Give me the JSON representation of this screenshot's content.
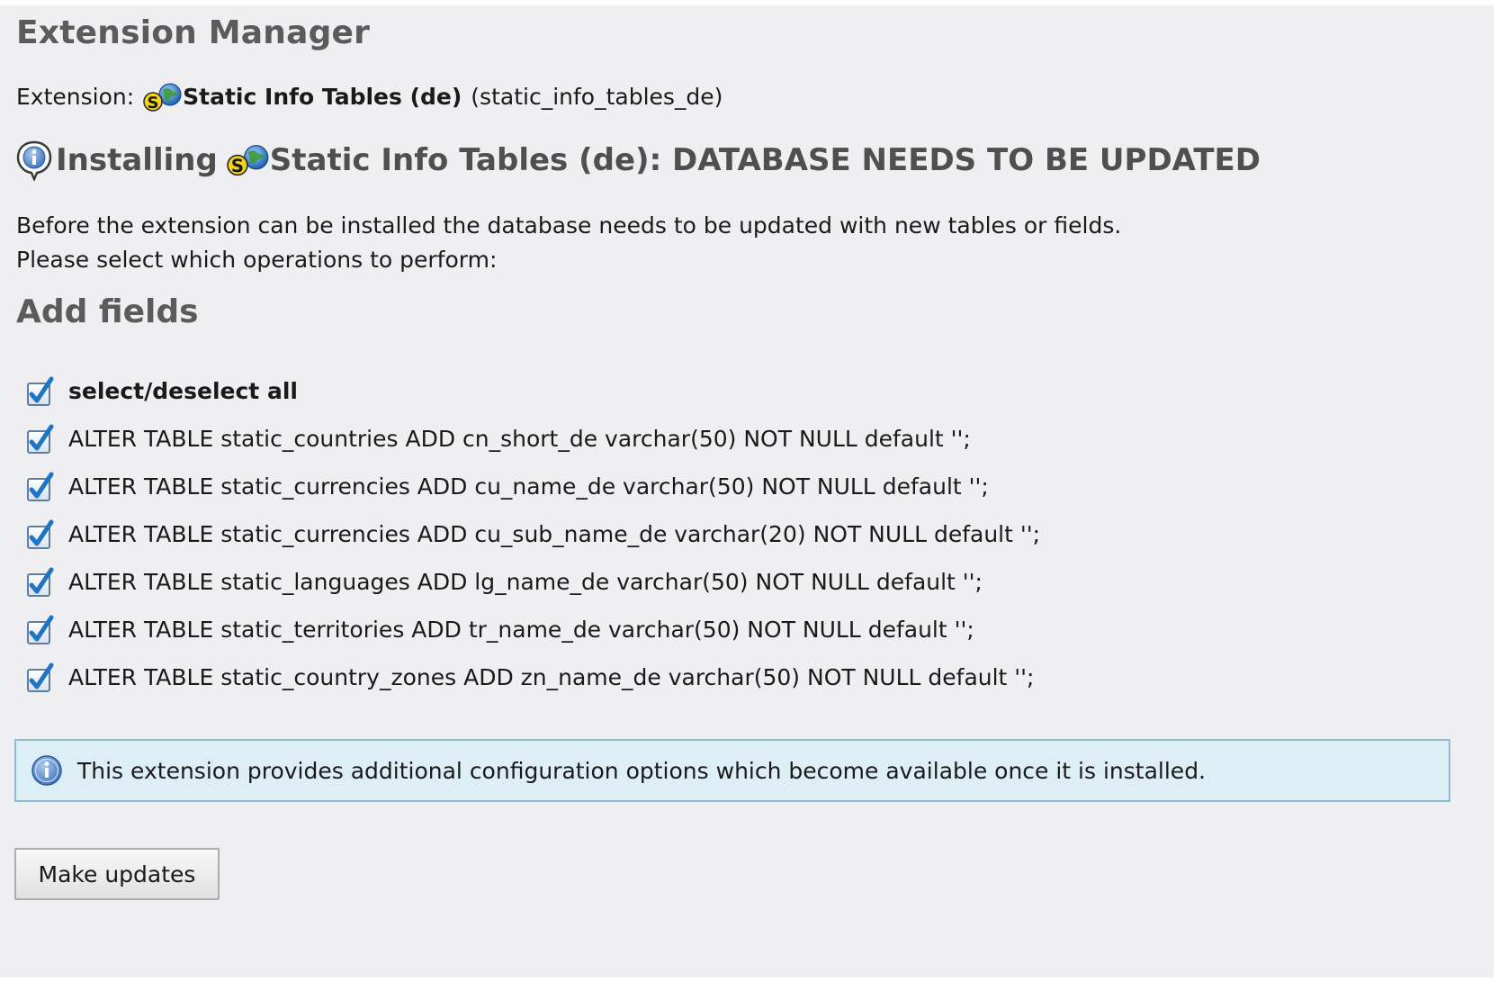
{
  "header": {
    "title": "Extension Manager"
  },
  "extension": {
    "label": "Extension:",
    "name": "Static Info Tables (de)",
    "key": "(static_info_tables_de)",
    "icon": "static-info-tables-icon"
  },
  "install": {
    "prefix": "Installing",
    "name": "Static Info Tables (de)",
    "status": ": DATABASE NEEDS TO BE UPDATED",
    "icon": "info-bubble-icon"
  },
  "intro": {
    "line1": "Before the extension can be installed the database needs to be updated with new tables or fields.",
    "line2": "Please select which operations to perform:"
  },
  "add_fields": {
    "title": "Add fields",
    "select_all": {
      "label": "select/deselect all",
      "checked": true
    },
    "operations": [
      {
        "sql": "ALTER TABLE static_countries ADD cn_short_de varchar(50) NOT NULL default '';",
        "checked": true
      },
      {
        "sql": "ALTER TABLE static_currencies ADD cu_name_de varchar(50) NOT NULL default '';",
        "checked": true
      },
      {
        "sql": "ALTER TABLE static_currencies ADD cu_sub_name_de varchar(20) NOT NULL default '';",
        "checked": true
      },
      {
        "sql": "ALTER TABLE static_languages ADD lg_name_de varchar(50) NOT NULL default '';",
        "checked": true
      },
      {
        "sql": "ALTER TABLE static_territories ADD tr_name_de varchar(50) NOT NULL default '';",
        "checked": true
      },
      {
        "sql": "ALTER TABLE static_country_zones ADD zn_name_de varchar(50) NOT NULL default '';",
        "checked": true
      }
    ]
  },
  "notice": {
    "text": "This extension provides additional configuration options which become available once it is installed.",
    "icon": "info-circle-icon"
  },
  "actions": {
    "make_updates_label": "Make updates"
  },
  "colors": {
    "panel_background": "#efeff1",
    "heading_gray": "#5b5b5b",
    "notice_background": "#ddeef5",
    "notice_border": "#8fbad0",
    "checkbox_blue": "#1f74c4"
  }
}
